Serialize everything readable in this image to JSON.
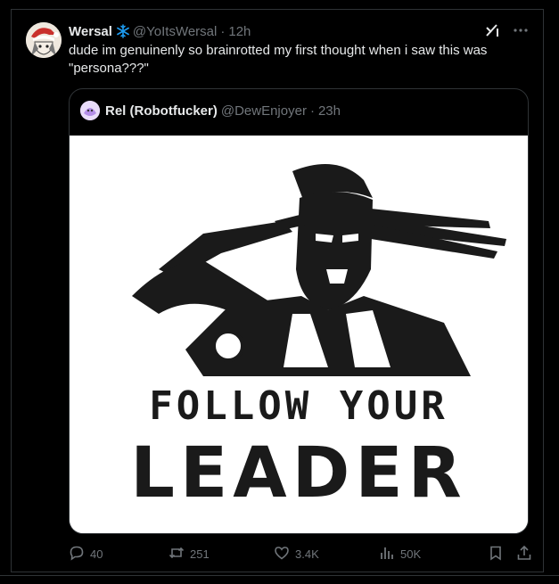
{
  "tweet": {
    "author_name": "Wersal",
    "author_handle": "@YoItsWersal",
    "separator": "·",
    "time": "12h",
    "text": "dude im genuinenly so brainrotted my first thought when i saw this was \"persona???\""
  },
  "quoted": {
    "author_name": "Rel (Robotfucker)",
    "author_handle": "@DewEnjoyer",
    "separator": "·",
    "time": "23h",
    "image": {
      "line1": "FOLLOW YOUR",
      "line2": "LEADER"
    }
  },
  "actions": {
    "replies": "40",
    "reposts": "251",
    "likes": "3.4K",
    "views": "50K"
  },
  "icons": {
    "verified": "snowflake-icon",
    "grok": "grok-icon",
    "more": "more-icon",
    "reply": "reply-icon",
    "repost": "repost-icon",
    "like": "like-icon",
    "views": "views-icon",
    "bookmark": "bookmark-icon",
    "share": "share-icon"
  },
  "colors": {
    "background": "#000000",
    "text": "#e7e9ea",
    "secondary": "#71767b",
    "border": "#2f3336",
    "verified": "#1d9bf0"
  }
}
